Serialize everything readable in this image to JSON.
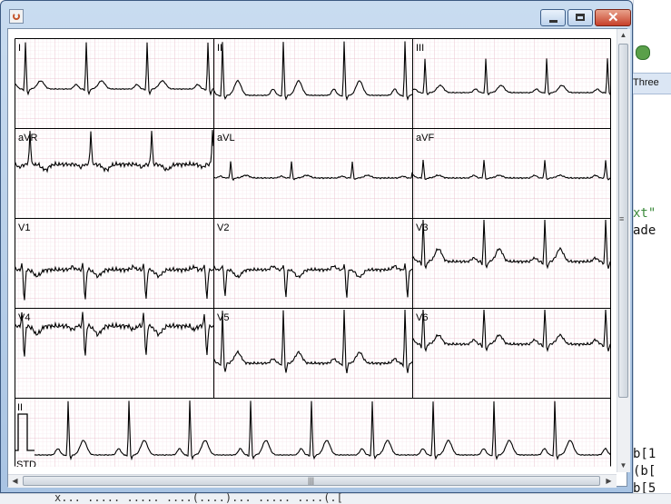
{
  "window": {
    "title": ""
  },
  "leads": [
    "I",
    "II",
    "III",
    "aVR",
    "aVL",
    "aVF",
    "V1",
    "V2",
    "V3",
    "V4",
    "V5",
    "V6"
  ],
  "rhythm": {
    "lead": "II",
    "calibration_label": "STD"
  },
  "background": {
    "tab_partial": "Three",
    "code_lines": [
      "xt\"",
      "ade",
      "b[1",
      "(b[",
      "b[5"
    ],
    "bottom_text": "x... ..... ..... ....(....)... ..... ....(.["
  },
  "icons": {
    "app": "java-cup-icon",
    "minimize": "minimize-icon",
    "maximize": "maximize-icon",
    "close": "close-icon"
  },
  "colors": {
    "grid_minor": "#f3dde4",
    "grid_major": "#e6b4c3",
    "trace": "#000000"
  }
}
